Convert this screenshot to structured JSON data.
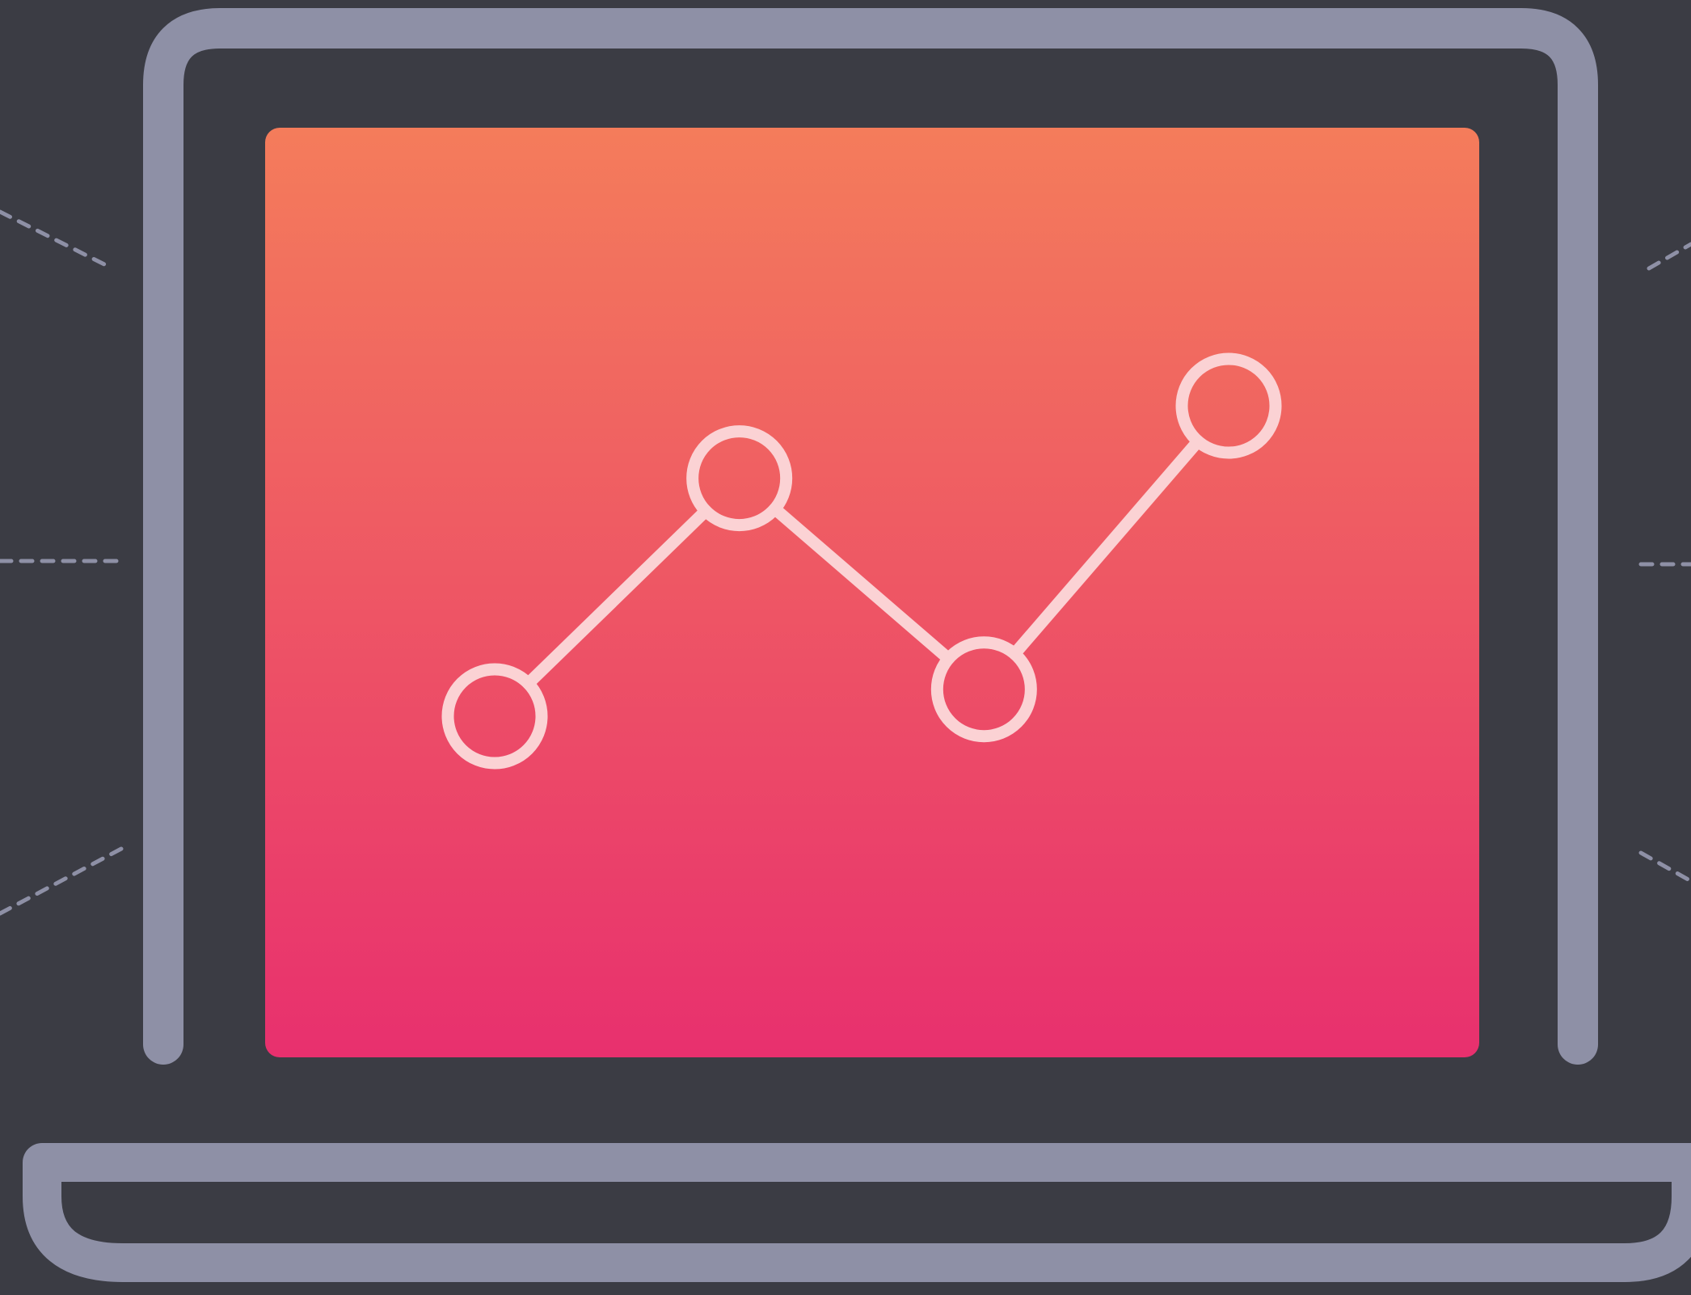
{
  "illustration": {
    "subject": "laptop-line-chart-icon",
    "colors": {
      "background": "#3b3c44",
      "frame": "#8e90a6",
      "screen_top": "#f47c5b",
      "screen_bottom": "#e8306e",
      "line": "#fbd2d4",
      "dashes": "#8e90a6"
    }
  },
  "icon_data": {
    "type": "line",
    "points": [
      {
        "x": 1,
        "y": 1.0
      },
      {
        "x": 2,
        "y": 2.15
      },
      {
        "x": 3,
        "y": 1.13
      },
      {
        "x": 4,
        "y": 2.5
      }
    ],
    "xlim": [
      1,
      4
    ],
    "ylim": [
      1.0,
      2.5
    ]
  }
}
